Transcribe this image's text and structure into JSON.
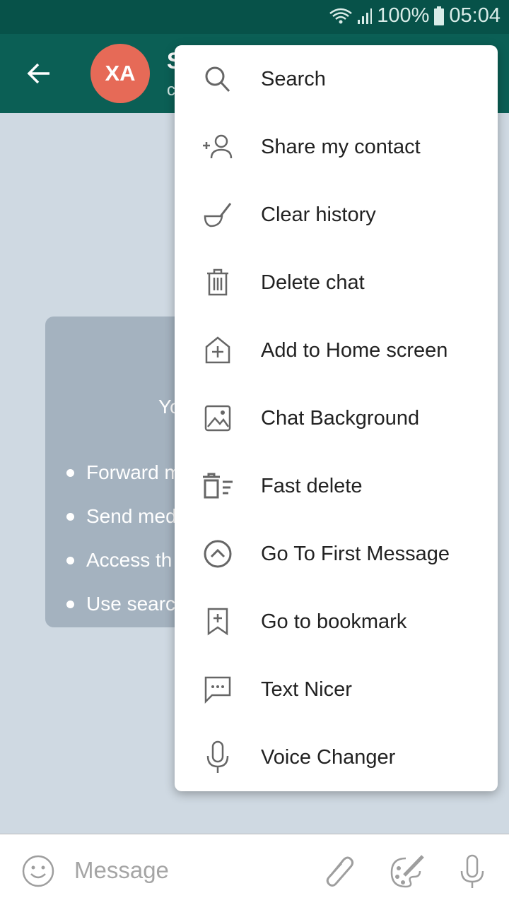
{
  "status_bar": {
    "battery": "100%",
    "time": "05:04",
    "icons": [
      "wifi-icon",
      "signal-icon",
      "battery-icon"
    ]
  },
  "toolbar": {
    "avatar_initials": "XA",
    "title": "S",
    "subtitle": "c",
    "avatar_color": "#e66a57",
    "bar_color": "#0b5f55"
  },
  "card": {
    "heading": "Yo",
    "bullets": [
      "Forward m",
      "Send med",
      "Access th",
      "Use searc"
    ]
  },
  "menu": {
    "items": [
      {
        "label": "Search",
        "icon": "search-icon"
      },
      {
        "label": "Share my contact",
        "icon": "add-contact-icon"
      },
      {
        "label": "Clear history",
        "icon": "broom-icon"
      },
      {
        "label": "Delete chat",
        "icon": "trash-icon"
      },
      {
        "label": "Add to Home screen",
        "icon": "home-add-icon"
      },
      {
        "label": "Chat Background",
        "icon": "image-icon"
      },
      {
        "label": "Fast delete",
        "icon": "fast-delete-icon"
      },
      {
        "label": "Go To First Message",
        "icon": "chevron-up-circle-icon"
      },
      {
        "label": "Go to bookmark",
        "icon": "bookmark-add-icon"
      },
      {
        "label": "Text Nicer",
        "icon": "chat-dots-icon"
      },
      {
        "label": "Voice Changer",
        "icon": "microphone-icon"
      }
    ]
  },
  "composer": {
    "placeholder": "Message"
  }
}
